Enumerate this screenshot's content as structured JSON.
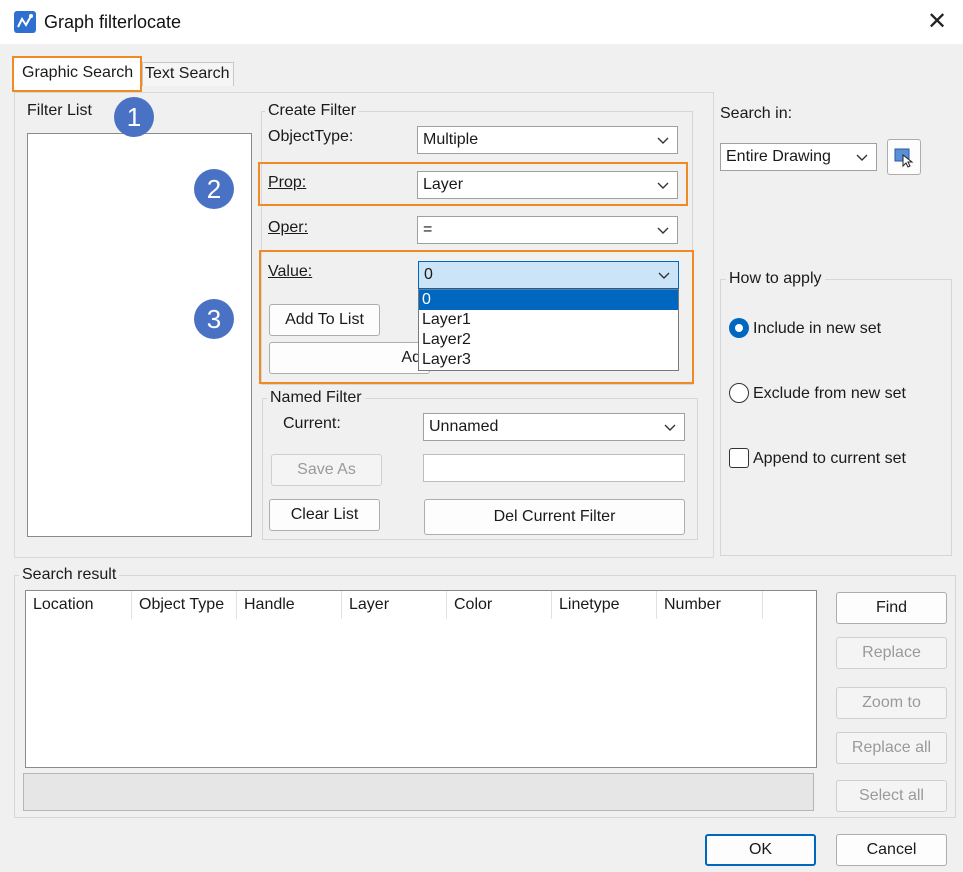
{
  "window": {
    "title": "Graph filterlocate",
    "app_icon": "graph-filter-app-icon",
    "close_icon": "close-icon"
  },
  "tabs": [
    {
      "label": "Graphic Search",
      "active": true
    },
    {
      "label": "Text Search",
      "active": false
    }
  ],
  "filter_list": {
    "label": "Filter List"
  },
  "create_filter": {
    "label": "Create Filter",
    "object_type_label": "ObjectType:",
    "object_type_value": "Multiple",
    "prop_label": "Prop:",
    "prop_value": "Layer",
    "oper_label": "Oper:",
    "oper_value": "=",
    "value_label": "Value:",
    "value_value": "0",
    "add_to_list": "Add To List",
    "hidden_button_label": "Ad",
    "value_options": [
      "0",
      "Layer1",
      "Layer2",
      "Layer3"
    ]
  },
  "named_filter": {
    "label": "Named Filter",
    "current_label": "Current:",
    "current_value": "Unnamed",
    "save_as": "Save As",
    "save_as_input": "",
    "clear_list": "Clear List",
    "del_current_filter": "Del Current Filter"
  },
  "search_in": {
    "label": "Search in:",
    "value": "Entire Drawing",
    "pick_icon": "select-objects-icon"
  },
  "how_to_apply": {
    "label": "How to apply",
    "include": "Include in new set",
    "exclude": "Exclude from new set",
    "append": "Append to current set",
    "selected": "include",
    "append_checked": false
  },
  "badges": [
    "1",
    "2",
    "3"
  ],
  "search_result": {
    "label": "Search result",
    "columns": [
      "Location",
      "Object Type",
      "Handle",
      "Layer",
      "Color",
      "Linetype",
      "Number"
    ],
    "rows": []
  },
  "side_buttons": {
    "find": "Find",
    "replace": "Replace",
    "zoom_to": "Zoom to",
    "replace_all": "Replace all",
    "select_all": "Select all"
  },
  "footer": {
    "ok": "OK",
    "cancel": "Cancel"
  },
  "colors": {
    "highlight": "#f08a24",
    "badge": "#4a72c4",
    "selection": "#0067c0"
  }
}
